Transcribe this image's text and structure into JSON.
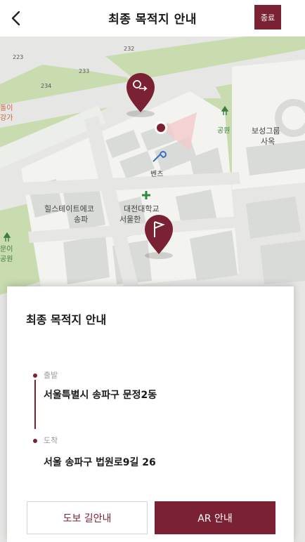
{
  "header": {
    "title": "최종 목적지 안내",
    "end_button": "종료"
  },
  "map": {
    "road_numbers": [
      "223",
      "232",
      "233",
      "234"
    ],
    "labels": {
      "left_top_1": "돌이",
      "left_top_2": "강가",
      "park": "공원",
      "bosung_1": "보성그룹",
      "bosung_2": "사옥",
      "benz": "벤츠",
      "hillstate_1": "힐스테이트에코",
      "hillstate_2": "송파",
      "univ_1": "대전대학교",
      "univ_2": "서울한",
      "left_park_1": "문이",
      "left_park_2": "공원"
    }
  },
  "sheet": {
    "title": "최종 목적지 안내",
    "start_label": "출발",
    "start_address": "서울특별시 송파구 문정2동",
    "end_label": "도착",
    "end_address": "서울 송파구 법원로9길 26",
    "walk_button": "도보 길안내",
    "ar_button": "AR 안내"
  },
  "colors": {
    "accent": "#7a2233",
    "park_green": "#c8dcb0",
    "block": "#f3f3ef",
    "building": "#d9dbd8",
    "road": "#e6e7e4"
  }
}
